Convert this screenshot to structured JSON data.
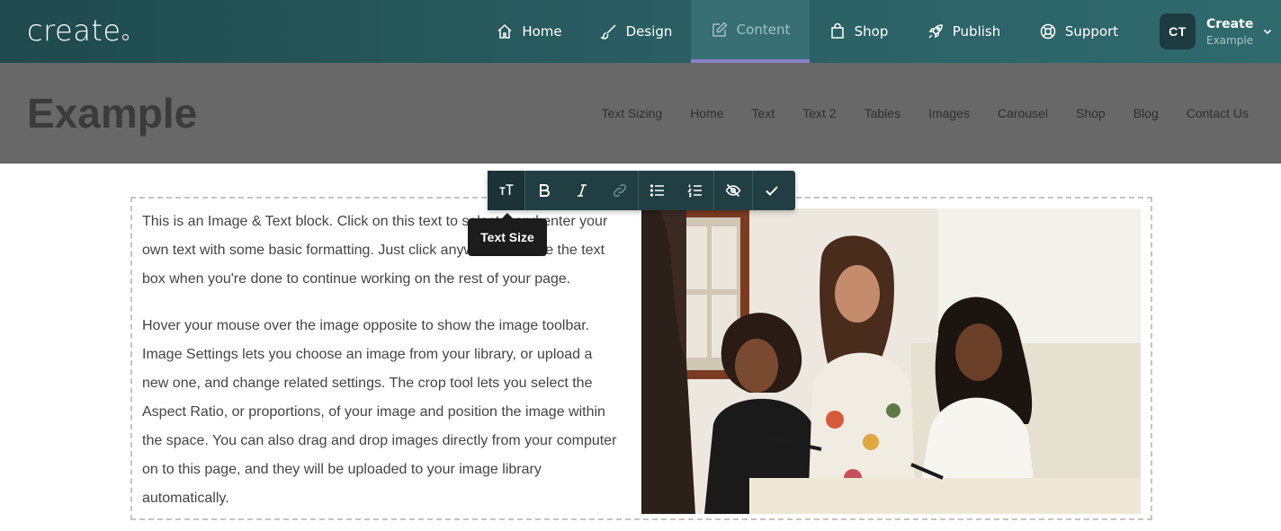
{
  "app": {
    "logo": "create",
    "nav": [
      {
        "label": "Home",
        "icon": "home-icon"
      },
      {
        "label": "Design",
        "icon": "brush-icon"
      },
      {
        "label": "Content",
        "icon": "edit-icon",
        "active": true
      },
      {
        "label": "Shop",
        "icon": "bag-icon"
      },
      {
        "label": "Publish",
        "icon": "rocket-icon"
      },
      {
        "label": "Support",
        "icon": "lifebuoy-icon"
      }
    ],
    "account": {
      "initials": "CT",
      "name": "Create",
      "site": "Example"
    }
  },
  "site": {
    "title": "Example",
    "nav": [
      "Text Sizing",
      "Home",
      "Text",
      "Text 2",
      "Tables",
      "Images",
      "Carousel",
      "Shop",
      "Blog",
      "Contact Us"
    ]
  },
  "toolbar": {
    "buttons": [
      "text-size",
      "bold",
      "italic",
      "link",
      "bullet-list",
      "numbered-list",
      "hide",
      "done"
    ],
    "tooltip": "Text Size"
  },
  "block": {
    "paragraphs": [
      "This is an Image & Text block. Click on this text to select it and enter your own text with some basic formatting. Just click anywhere outside the text box when you're done to continue working on the rest of your page.",
      "Hover your mouse over the image opposite to show the image toolbar. Image Settings lets you choose an image from your library, or upload a new one, and change related settings. The crop tool lets you select the Aspect Ratio, or proportions, of your image and position the image within the space. You can also drag and drop images directly from your computer on to this page, and they will be uploaded to your image library automatically."
    ]
  },
  "colors": {
    "topbar": "#2a5f63",
    "active_tab_underline": "#8a7fc8",
    "header_bg": "#686868",
    "toolbar": "#213f42"
  }
}
